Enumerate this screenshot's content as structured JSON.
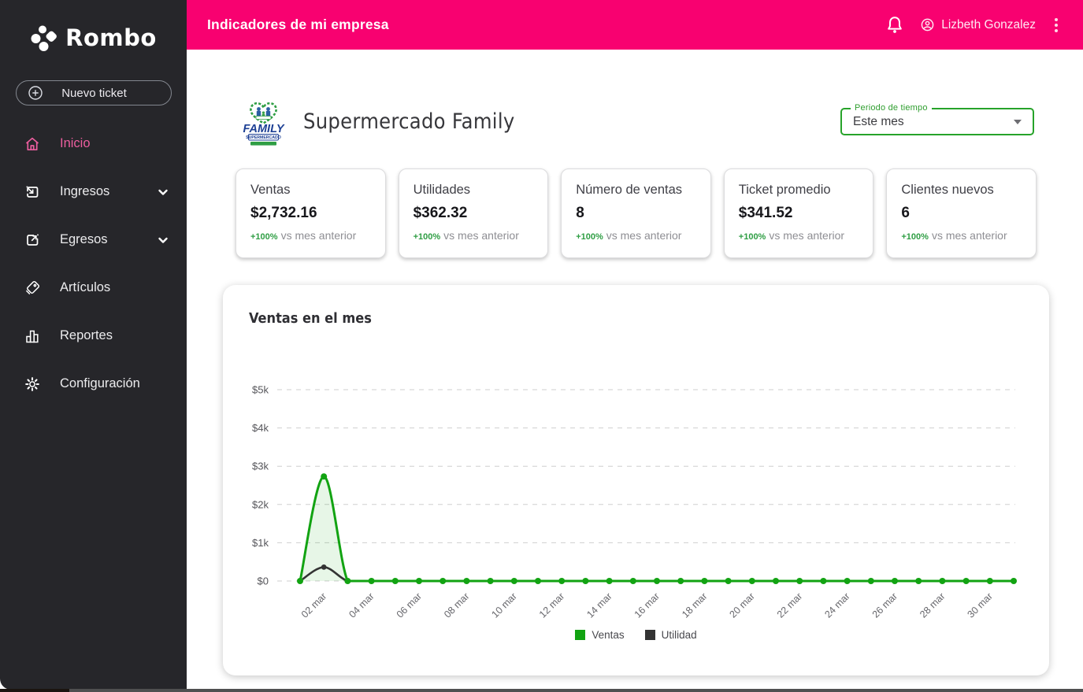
{
  "sidebar": {
    "logo_text": "Rombo",
    "new_ticket_label": "Nuevo ticket",
    "items": [
      {
        "label": "Inicio",
        "icon": "home-icon",
        "active": true,
        "expandable": false
      },
      {
        "label": "Ingresos",
        "icon": "ingresos-icon",
        "active": false,
        "expandable": true
      },
      {
        "label": "Egresos",
        "icon": "egresos-icon",
        "active": false,
        "expandable": true
      },
      {
        "label": "Artículos",
        "icon": "tag-icon",
        "active": false,
        "expandable": false
      },
      {
        "label": "Reportes",
        "icon": "bar-chart-icon",
        "active": false,
        "expandable": false
      },
      {
        "label": "Configuración",
        "icon": "gear-icon",
        "active": false,
        "expandable": false
      }
    ]
  },
  "topbar": {
    "title": "Indicadores de mi empresa",
    "user_name": "Lizbeth Gonzalez",
    "icons": [
      "bell-icon",
      "account-icon",
      "kebab-menu-icon"
    ]
  },
  "header": {
    "company_name": "Supermercado Family",
    "company_logo": {
      "line1": "FAMILY",
      "line2": "SUPERMERCADO"
    },
    "period_label": "Periodo de tiempo",
    "period_value": "Este mes"
  },
  "kpis": [
    {
      "title": "Ventas",
      "value": "$2,732.16",
      "delta": "+100%",
      "delta_suffix": "vs mes anterior"
    },
    {
      "title": "Utilidades",
      "value": "$362.32",
      "delta": "+100%",
      "delta_suffix": "vs mes anterior"
    },
    {
      "title": "Número de ventas",
      "value": "8",
      "delta": "+100%",
      "delta_suffix": "vs mes anterior"
    },
    {
      "title": "Ticket promedio",
      "value": "$341.52",
      "delta": "+100%",
      "delta_suffix": "vs mes anterior"
    },
    {
      "title": "Clientes nuevos",
      "value": "6",
      "delta": "+100%",
      "delta_suffix": "vs mes anterior"
    }
  ],
  "chart": {
    "title": "Ventas en el mes"
  },
  "chart_data": {
    "type": "line",
    "title": "Ventas en el mes",
    "x": [
      "01 mar",
      "02 mar",
      "03 mar",
      "04 mar",
      "05 mar",
      "06 mar",
      "07 mar",
      "08 mar",
      "09 mar",
      "10 mar",
      "11 mar",
      "12 mar",
      "13 mar",
      "14 mar",
      "15 mar",
      "16 mar",
      "17 mar",
      "18 mar",
      "19 mar",
      "20 mar",
      "21 mar",
      "22 mar",
      "23 mar",
      "24 mar",
      "25 mar",
      "26 mar",
      "27 mar",
      "28 mar",
      "29 mar",
      "30 mar",
      "31 mar"
    ],
    "x_tick_labels": [
      "02 mar",
      "04 mar",
      "06 mar",
      "08 mar",
      "10 mar",
      "12 mar",
      "14 mar",
      "16 mar",
      "18 mar",
      "20 mar",
      "22 mar",
      "24 mar",
      "26 mar",
      "28 mar",
      "30 mar"
    ],
    "series": [
      {
        "name": "Ventas",
        "color": "#12a312",
        "values": [
          0,
          2732.16,
          0,
          0,
          0,
          0,
          0,
          0,
          0,
          0,
          0,
          0,
          0,
          0,
          0,
          0,
          0,
          0,
          0,
          0,
          0,
          0,
          0,
          0,
          0,
          0,
          0,
          0,
          0,
          0,
          0
        ]
      },
      {
        "name": "Utilidad",
        "color": "#333333",
        "values": [
          0,
          362.32,
          0,
          0,
          0,
          0,
          0,
          0,
          0,
          0,
          0,
          0,
          0,
          0,
          0,
          0,
          0,
          0,
          0,
          0,
          0,
          0,
          0,
          0,
          0,
          0,
          0,
          0,
          0,
          0,
          0
        ]
      }
    ],
    "ylim": [
      0,
      5000
    ],
    "y_ticks": [
      "$0",
      "$1k",
      "$2k",
      "$3k",
      "$4k",
      "$5k"
    ],
    "grid": true,
    "legend_position": "bottom"
  },
  "colors": {
    "topbar_pink": "#f80170",
    "active_pink": "#ec5e9f",
    "sidebar_bg": "#26262a",
    "accent_green": "#12a312",
    "select_green": "#27a32a",
    "grid_gray": "#cfcfcf"
  }
}
